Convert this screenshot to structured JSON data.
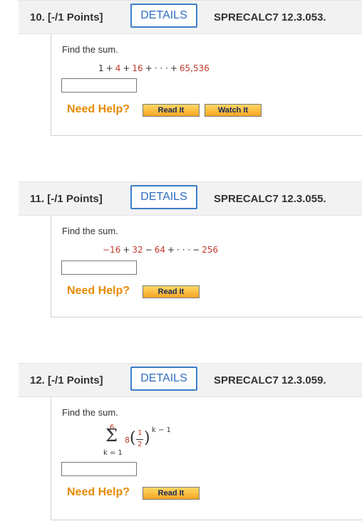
{
  "common": {
    "details_label": "DETAILS",
    "prompt": "Find the sum.",
    "need_help": "Need Help?",
    "read_it": "Read It",
    "watch_it": "Watch It"
  },
  "questions": [
    {
      "number": "10.",
      "points": "[-/1 Points]",
      "code": "SPRECALC7 12.3.053.",
      "expr": [
        "1",
        "+",
        "4",
        "+",
        "16",
        "+",
        "· · ·",
        "+",
        "65,536"
      ]
    },
    {
      "number": "11.",
      "points": "[-/1 Points]",
      "code": "SPRECALC7 12.3.055.",
      "expr": [
        "−16",
        "+",
        "32",
        "−",
        "64",
        "+",
        "· · ·",
        "−",
        "256"
      ]
    },
    {
      "number": "12.",
      "points": "[-/1 Points]",
      "code": "SPRECALC7 12.3.059.",
      "sum": {
        "sigma": "Σ",
        "upper": "6",
        "lower": "k = 1",
        "coef": "8",
        "num": "1",
        "den": "2",
        "exponent": "k − 1"
      }
    }
  ]
}
